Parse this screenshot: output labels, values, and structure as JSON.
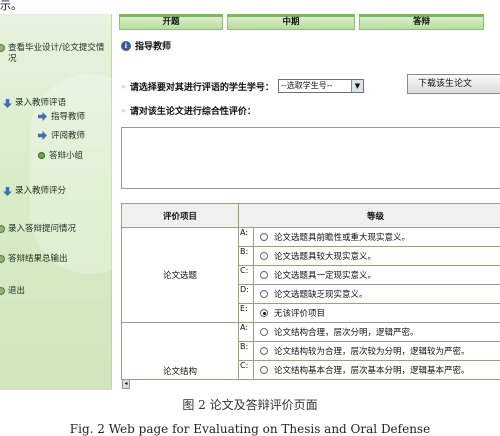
{
  "fragment_top": "示。",
  "sidebar": {
    "items": [
      {
        "label": "查看毕业设计/论文提交情况"
      },
      {
        "label": "录入教师评语"
      },
      {
        "label": "录入教师评分"
      },
      {
        "label": "录入答辩提问情况"
      },
      {
        "label": "答辩结果总输出"
      },
      {
        "label": "退出"
      }
    ],
    "sub_items": [
      {
        "label": "指导教师"
      },
      {
        "label": "评阅教师"
      },
      {
        "label": "答辩小组"
      }
    ]
  },
  "tabs": [
    "开题",
    "中期",
    "答辩"
  ],
  "section_title": "指导教师",
  "select_row": {
    "label": "请选择要对其进行评语的学生学号：",
    "select_value": "--选取学生号--",
    "download_button": "下载该生论文"
  },
  "comment_row": {
    "label": "请对该生论文进行综合性评价："
  },
  "table": {
    "headers": [
      "评价项目",
      "等级"
    ],
    "groups": [
      {
        "item": "论文选题",
        "options": [
          {
            "letter": "A:",
            "text": "论文选题具前瞻性或重大现实意义。",
            "selected": false
          },
          {
            "letter": "B:",
            "text": "论文选题具较大现实意义。",
            "selected": false
          },
          {
            "letter": "C:",
            "text": "论文选题具一定现实意义。",
            "selected": false
          },
          {
            "letter": "D:",
            "text": "论文选题缺乏现实意义。",
            "selected": false
          },
          {
            "letter": "E:",
            "text": "无该评价项目",
            "selected": true
          }
        ]
      },
      {
        "item": "论文结构",
        "options": [
          {
            "letter": "A:",
            "text": "论文结构合理，层次分明，逻辑严密。",
            "selected": false
          },
          {
            "letter": "B:",
            "text": "论文结构较为合理，层次较为分明，逻辑较为严密。",
            "selected": false
          },
          {
            "letter": "C:",
            "text": "论文结构基本合理，层次基本分明，逻辑基本严密。",
            "selected": false
          }
        ]
      }
    ]
  },
  "caption_cn": "图 2 论文及答辩评价页面",
  "caption_en": "Fig. 2 Web page for Evaluating on Thesis and Oral Defense"
}
